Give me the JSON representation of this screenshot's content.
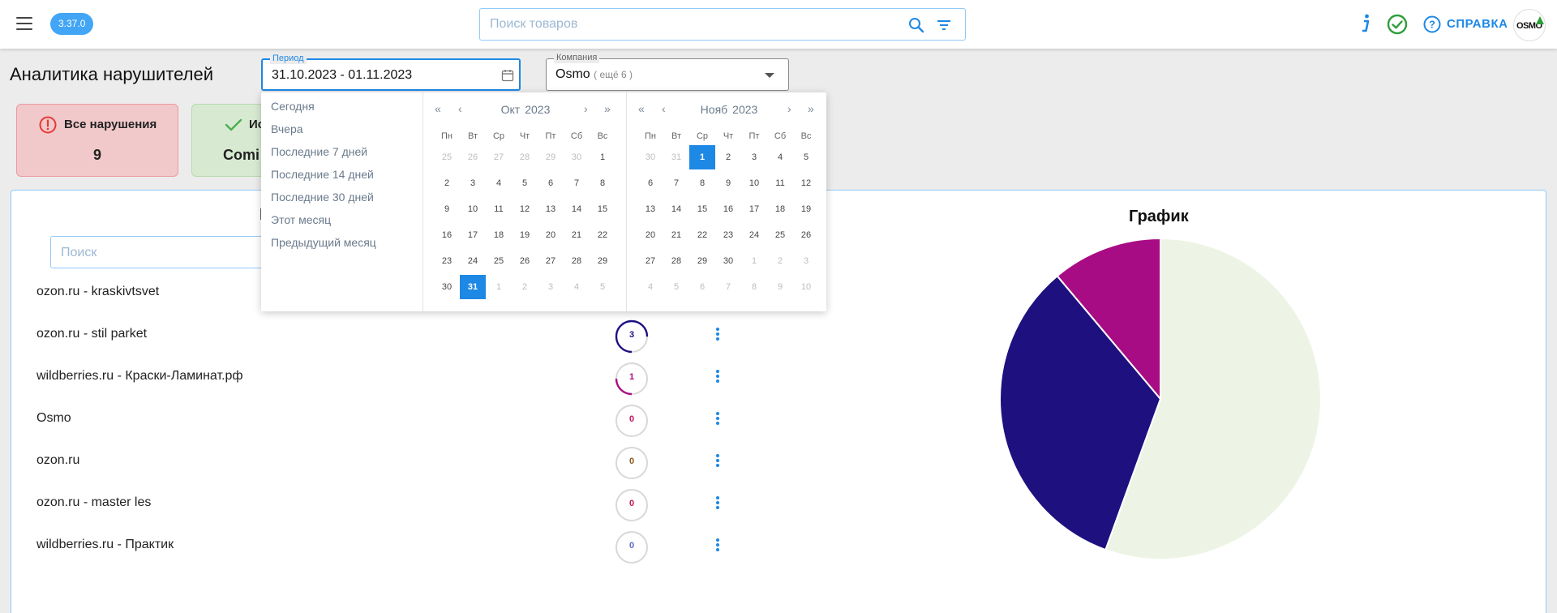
{
  "header": {
    "version": "3.37.0",
    "search_placeholder": "Поиск товаров",
    "help_label": "СПРАВКА",
    "logo_text": "OSMO"
  },
  "page": {
    "title": "Аналитика нарушителей",
    "period_label": "Период",
    "period_value": "31.10.2023 - 01.11.2023",
    "company_label": "Компания",
    "company_value": "Osmo",
    "company_more": "( ещё 6 )"
  },
  "cards": [
    {
      "title": "Все нарушения",
      "value": "9"
    },
    {
      "title": "Ис",
      "value": "Comi"
    }
  ],
  "list": {
    "title": "Ко",
    "search_placeholder": "Поиск",
    "rows": [
      {
        "name": "ozon.ru - kraskivtsvet",
        "count": null
      },
      {
        "name": "ozon.ru - stil parket",
        "count": "3"
      },
      {
        "name": "wildberries.ru - Краски-Ламинат.рф",
        "count": "1"
      },
      {
        "name": "Osmo",
        "count": "0"
      },
      {
        "name": "ozon.ru",
        "count": "0"
      },
      {
        "name": "ozon.ru - master les",
        "count": "0"
      },
      {
        "name": "wildberries.ru - Практик",
        "count": "0"
      }
    ]
  },
  "chart": {
    "title": "График"
  },
  "chart_data": {
    "type": "pie",
    "title": "График",
    "slices": [
      {
        "value": 5,
        "color": "#eef4e5"
      },
      {
        "value": 3,
        "color": "#1f1080"
      },
      {
        "value": 1,
        "color": "#a80c84"
      }
    ]
  },
  "datepicker": {
    "presets": [
      "Сегодня",
      "Вчера",
      "Последние 7 дней",
      "Последние 14 дней",
      "Последние 30 дней",
      "Этот месяц",
      "Предыдущий месяц"
    ],
    "weekdays": [
      "Пн",
      "Вт",
      "Ср",
      "Чт",
      "Пт",
      "Сб",
      "Вс"
    ],
    "calendars": [
      {
        "month": "Окт",
        "year": "2023",
        "days": [
          [
            "25",
            "26",
            "27",
            "28",
            "29",
            "30",
            "1"
          ],
          [
            "2",
            "3",
            "4",
            "5",
            "6",
            "7",
            "8"
          ],
          [
            "9",
            "10",
            "11",
            "12",
            "13",
            "14",
            "15"
          ],
          [
            "16",
            "17",
            "18",
            "19",
            "20",
            "21",
            "22"
          ],
          [
            "23",
            "24",
            "25",
            "26",
            "27",
            "28",
            "29"
          ],
          [
            "30",
            "31",
            "1",
            "2",
            "3",
            "4",
            "5"
          ]
        ],
        "muted": [
          [
            0,
            0
          ],
          [
            0,
            1
          ],
          [
            0,
            2
          ],
          [
            0,
            3
          ],
          [
            0,
            4
          ],
          [
            0,
            5
          ],
          [
            5,
            2
          ],
          [
            5,
            3
          ],
          [
            5,
            4
          ],
          [
            5,
            5
          ],
          [
            5,
            6
          ]
        ],
        "selected": [
          5,
          1
        ]
      },
      {
        "month": "Нояб",
        "year": "2023",
        "days": [
          [
            "30",
            "31",
            "1",
            "2",
            "3",
            "4",
            "5"
          ],
          [
            "6",
            "7",
            "8",
            "9",
            "10",
            "11",
            "12"
          ],
          [
            "13",
            "14",
            "15",
            "16",
            "17",
            "18",
            "19"
          ],
          [
            "20",
            "21",
            "22",
            "23",
            "24",
            "25",
            "26"
          ],
          [
            "27",
            "28",
            "29",
            "30",
            "1",
            "2",
            "3"
          ],
          [
            "4",
            "5",
            "6",
            "7",
            "8",
            "9",
            "10"
          ]
        ],
        "muted": [
          [
            0,
            0
          ],
          [
            0,
            1
          ],
          [
            4,
            4
          ],
          [
            4,
            5
          ],
          [
            4,
            6
          ],
          [
            5,
            0
          ],
          [
            5,
            1
          ],
          [
            5,
            2
          ],
          [
            5,
            3
          ],
          [
            5,
            4
          ],
          [
            5,
            5
          ],
          [
            5,
            6
          ]
        ],
        "selected": [
          0,
          2
        ]
      }
    ]
  },
  "colors": {
    "accent": "#1e88e5",
    "ok_green": "#2e9e3b",
    "alert_red": "#e53935"
  }
}
